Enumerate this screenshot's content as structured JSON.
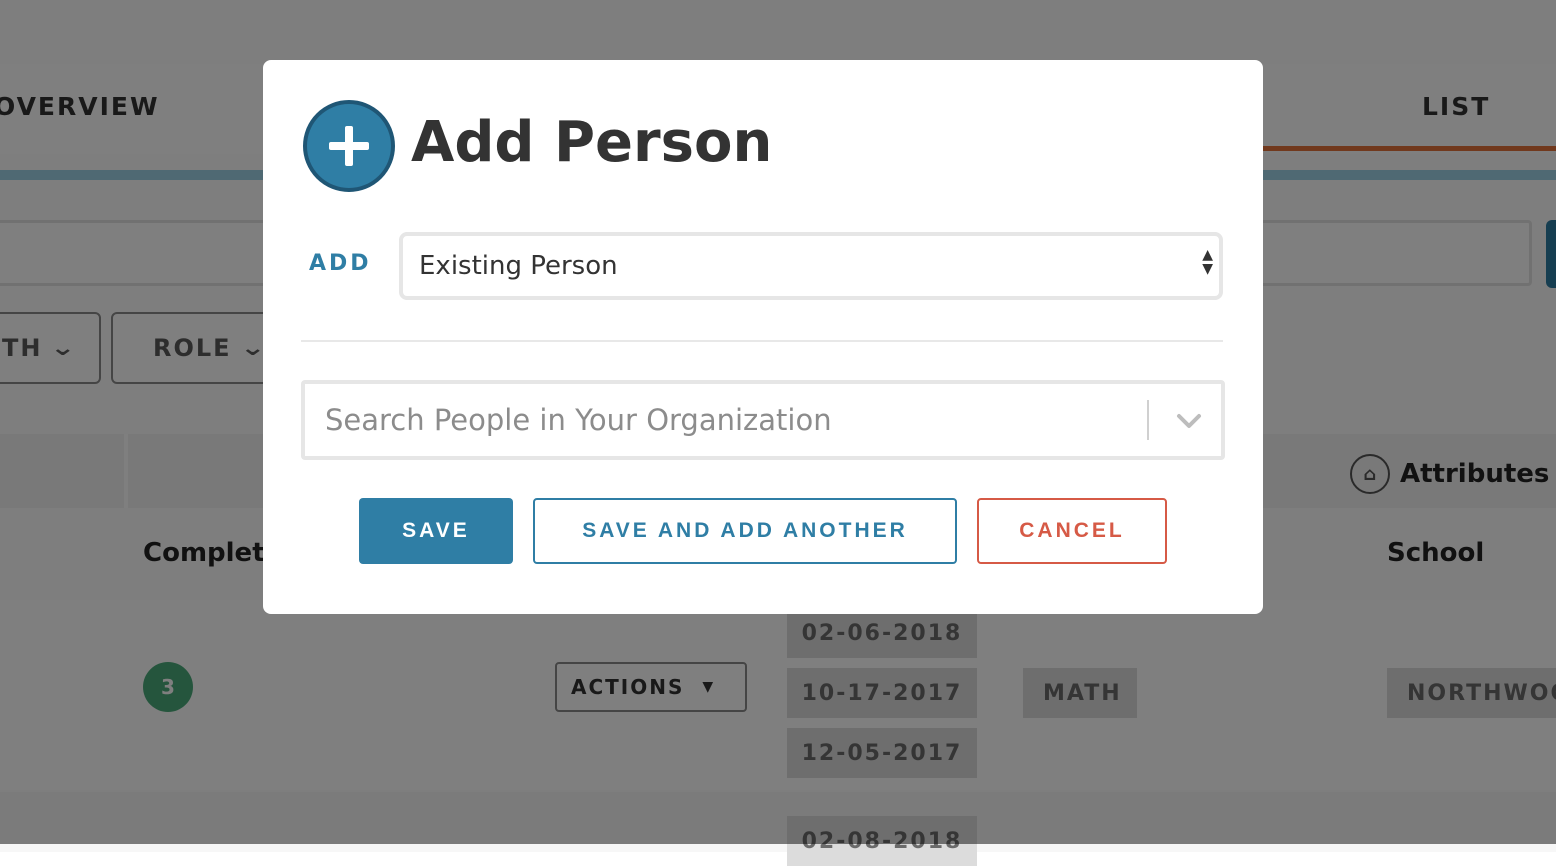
{
  "background": {
    "tabs": {
      "overview": "OVERVIEW",
      "list": "LIST"
    },
    "filters": {
      "month": "TH",
      "role": "ROLE"
    },
    "table": {
      "attributes_header": "Attributes",
      "complete_header": "Complete",
      "school_header": "School",
      "count": "3",
      "actions_label": "ACTIONS",
      "dates": [
        "02-06-2018",
        "10-17-2017",
        "12-05-2017",
        "02-08-2018"
      ],
      "subject_tag": "MATH",
      "school_tag": "NORTHWOO"
    }
  },
  "modal": {
    "title": "Add Person",
    "add_label": "ADD",
    "add_select_value": "Existing Person",
    "search_placeholder": "Search People in Your Organization",
    "buttons": {
      "save": "SAVE",
      "save_and_add_another": "SAVE AND ADD ANOTHER",
      "cancel": "CANCEL"
    }
  },
  "colors": {
    "accent": "#2f7ea5",
    "cancel": "#d65a46",
    "tab_underline": "#e2733a",
    "badge": "#4bab7a"
  },
  "icons": [
    "plus-circle-icon",
    "select-arrows-icon",
    "chevron-down-icon",
    "tag-icon",
    "caret-down-icon"
  ]
}
